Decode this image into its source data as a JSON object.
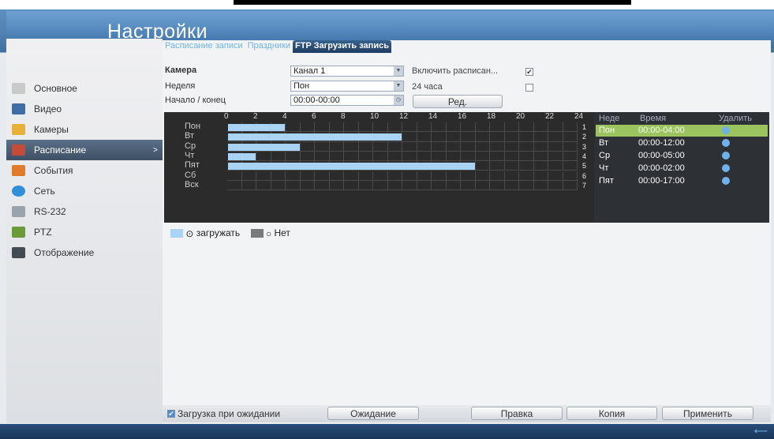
{
  "title": "Настройки",
  "sidebar": {
    "items": [
      {
        "label": "Основное",
        "icon": "gear-icon",
        "color": "#c9c9c9"
      },
      {
        "label": "Видео",
        "icon": "monitor-icon",
        "color": "#3f6ea6"
      },
      {
        "label": "Камеры",
        "icon": "camera-icon",
        "color": "#e8b23a"
      },
      {
        "label": "Расписание",
        "icon": "calendar-icon",
        "color": "#c44a3a"
      },
      {
        "label": "События",
        "icon": "events-icon",
        "color": "#e07b2b"
      },
      {
        "label": "Сеть",
        "icon": "globe-icon",
        "color": "#2f8fd8"
      },
      {
        "label": "RS-232",
        "icon": "cable-icon",
        "color": "#9aa3ad"
      },
      {
        "label": "PTZ",
        "icon": "ptz-icon",
        "color": "#6a9a3a"
      },
      {
        "label": "Отображение",
        "icon": "display-icon",
        "color": "#444a52"
      }
    ],
    "selected_arrow": ">"
  },
  "tabs": [
    "Расписание записи",
    "Праздники",
    "FTP Загрузить запись"
  ],
  "form": {
    "camera_label": "Камера",
    "camera_value": "Канал 1",
    "enable_label": "Включить расписан...",
    "enable_checked": "✔",
    "week_label": "Неделя",
    "week_value": "Пон",
    "all_day_label": "24 часа",
    "startend_label": "Начало / конец",
    "startend_value": "00:00-00:00",
    "edit_button": "Ред."
  },
  "grid": {
    "hours": [
      "0",
      "2",
      "4",
      "6",
      "8",
      "10",
      "12",
      "14",
      "16",
      "18",
      "20",
      "22",
      "24"
    ],
    "days": [
      {
        "label": "Пон",
        "num": "1",
        "end": 4
      },
      {
        "label": "Вт",
        "num": "2",
        "end": 12
      },
      {
        "label": "Ср",
        "num": "3",
        "end": 5
      },
      {
        "label": "Чт",
        "num": "4",
        "end": 2
      },
      {
        "label": "Пят",
        "num": "5",
        "end": 17
      },
      {
        "label": "Сб",
        "num": "6",
        "end": 0
      },
      {
        "label": "Вск",
        "num": "7",
        "end": 0
      }
    ]
  },
  "table": {
    "headers": [
      "Неде",
      "Время",
      "Удалить"
    ],
    "rows": [
      {
        "day": "Пон",
        "time": "00:00-04:00"
      },
      {
        "day": "Вт",
        "time": "00:00-12:00"
      },
      {
        "day": "Ср",
        "time": "00:00-05:00"
      },
      {
        "day": "Чт",
        "time": "00:00-02:00"
      },
      {
        "day": "Пят",
        "time": "00:00-17:00"
      }
    ]
  },
  "legend": {
    "upload": "загружать",
    "none": "Нет"
  },
  "bottom": {
    "standby_upload_label": "Загрузка при ожидании",
    "standby_button": "Ожидание",
    "edit_button": "Правка",
    "copy_button": "Копия",
    "apply_button": "Применить"
  },
  "colors": {
    "segment": "#a9d3f4",
    "highlight_row": "#9cc45e"
  }
}
